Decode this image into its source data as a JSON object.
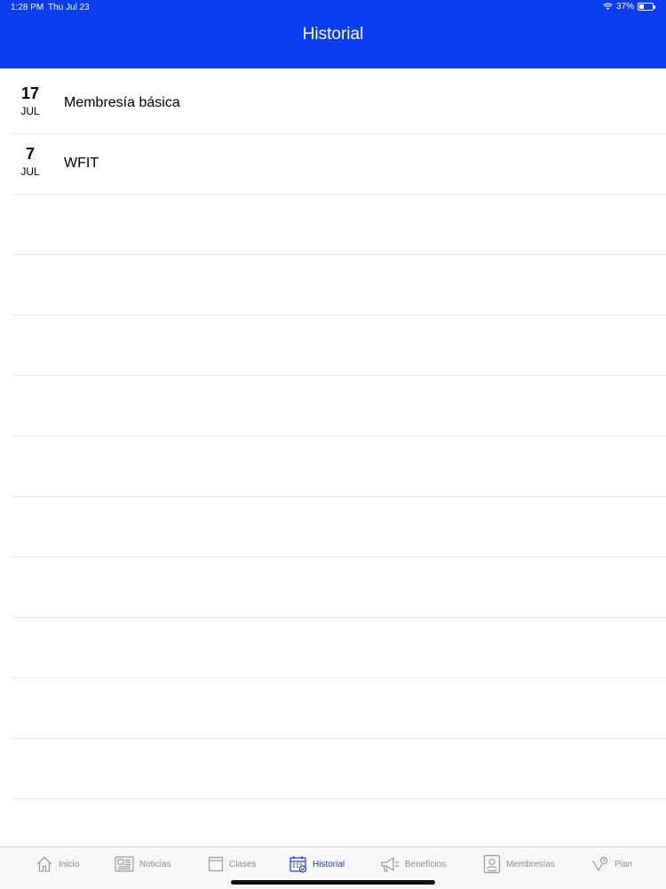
{
  "status_bar": {
    "time": "1:28 PM",
    "date": "Thu Jul 23",
    "battery": "37%",
    "battery_level": 0.37
  },
  "header": {
    "title": "Historial"
  },
  "history": [
    {
      "day": "17",
      "month": "JUL",
      "title": "Membresía básica"
    },
    {
      "day": "7",
      "month": "JUL",
      "title": "WFIT"
    }
  ],
  "tabs": [
    {
      "label": "Inicio",
      "icon": "home-icon",
      "active": false
    },
    {
      "label": "Noticias",
      "icon": "newspaper-icon",
      "active": false
    },
    {
      "label": "Clases",
      "icon": "folder-icon",
      "active": false
    },
    {
      "label": "Historial",
      "icon": "calendar-check-icon",
      "active": true
    },
    {
      "label": "Beneficios",
      "icon": "megaphone-icon",
      "active": false
    },
    {
      "label": "Membresías",
      "icon": "id-badge-icon",
      "active": false
    },
    {
      "label": "Plan",
      "icon": "plan-icon",
      "active": false
    }
  ],
  "colors": {
    "header": "#0a3cf0",
    "active_tab": "#1a3fc7",
    "inactive_tab": "#8e8e93"
  }
}
